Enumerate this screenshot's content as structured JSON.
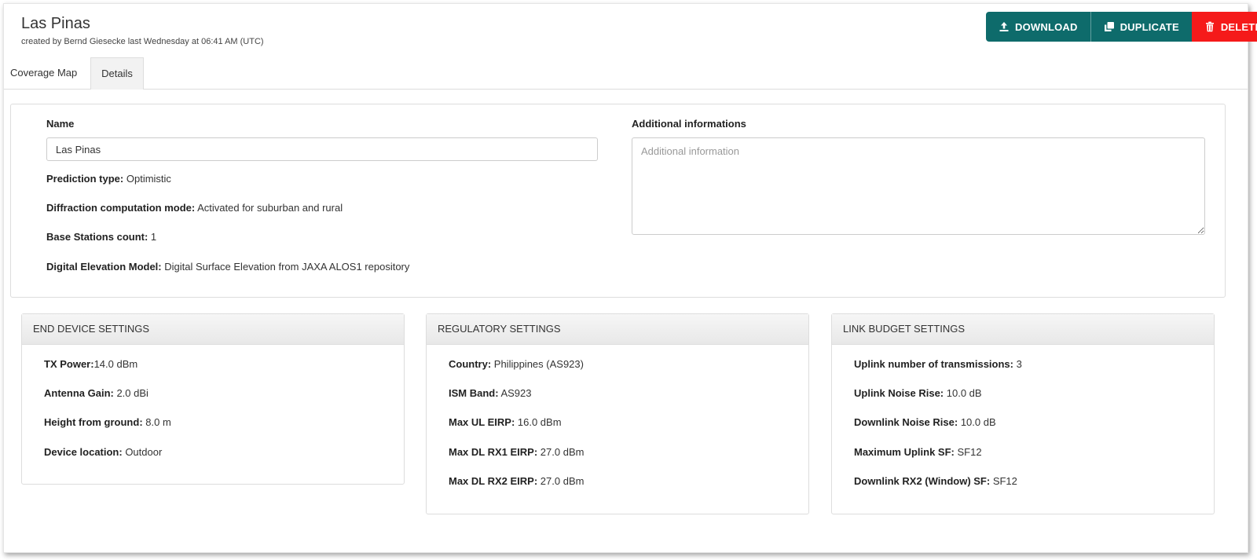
{
  "header": {
    "title": "Las Pinas",
    "subtitle": "created by Bernd Giesecke last Wednesday at 06:41 AM (UTC)"
  },
  "actions": {
    "download_label": "DOWNLOAD",
    "duplicate_label": "DUPLICATE",
    "delete_label": "DELETE"
  },
  "tabs": [
    {
      "label": "Coverage Map"
    },
    {
      "label": "Details"
    }
  ],
  "details": {
    "name_label": "Name",
    "name_value": "Las Pinas",
    "additional_label": "Additional informations",
    "additional_placeholder": "Additional information",
    "rows": [
      {
        "label": "Prediction type:",
        "value": " Optimistic"
      },
      {
        "label": "Diffraction computation mode:",
        "value": " Activated for suburban and rural"
      },
      {
        "label": "Base Stations count:",
        "value": " 1"
      },
      {
        "label": "Digital Elevation Model:",
        "value": " Digital Surface Elevation from JAXA ALOS1 repository"
      }
    ]
  },
  "end_device": {
    "title": "END DEVICE SETTINGS",
    "rows": [
      {
        "label": "TX Power:",
        "value": "14.0 dBm"
      },
      {
        "label": "Antenna Gain:",
        "value": " 2.0 dBi"
      },
      {
        "label": "Height from ground:",
        "value": " 8.0 m"
      },
      {
        "label": "Device location:",
        "value": " Outdoor"
      }
    ]
  },
  "regulatory": {
    "title": "REGULATORY SETTINGS",
    "rows": [
      {
        "label": "Country:",
        "value": " Philippines (AS923)"
      },
      {
        "label": "ISM Band:",
        "value": " AS923"
      },
      {
        "label": "Max UL EIRP:",
        "value": " 16.0 dBm"
      },
      {
        "label": "Max DL RX1 EIRP:",
        "value": " 27.0 dBm"
      },
      {
        "label": "Max DL RX2 EIRP:",
        "value": " 27.0 dBm"
      }
    ]
  },
  "link_budget": {
    "title": "LINK BUDGET SETTINGS",
    "rows": [
      {
        "label": "Uplink number of transmissions:",
        "value": " 3"
      },
      {
        "label": "Uplink Noise Rise:",
        "value": " 10.0 dB"
      },
      {
        "label": "Downlink Noise Rise:",
        "value": " 10.0 dB"
      },
      {
        "label": "Maximum Uplink SF:",
        "value": " SF12"
      },
      {
        "label": "Downlink RX2 (Window) SF:",
        "value": " SF12"
      }
    ]
  },
  "colors": {
    "teal": "#0e6b6b",
    "red": "#f51a1a"
  },
  "icons": {
    "download": "upload-arrow-icon",
    "duplicate": "copy-icon",
    "delete": "trash-icon"
  }
}
